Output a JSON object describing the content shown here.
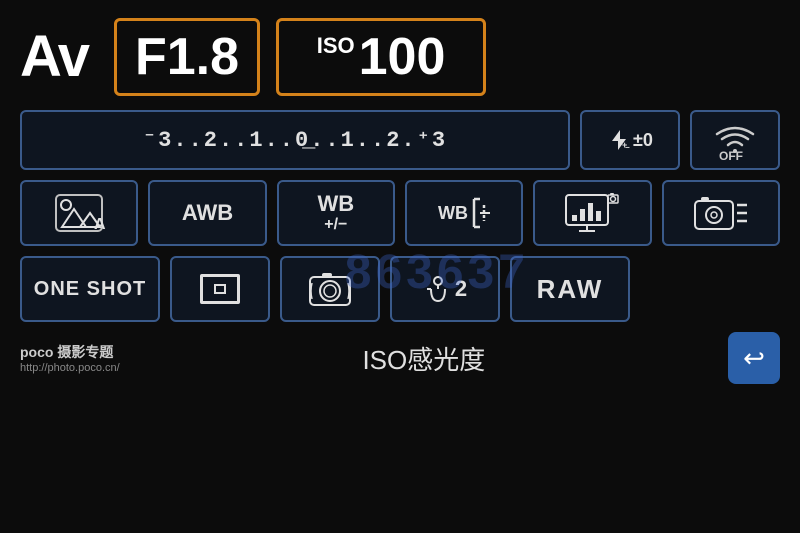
{
  "screen": {
    "mode": "Av",
    "aperture": "F1.8",
    "iso_label": "ISO",
    "iso_value": "100",
    "exposure_scale": "⁻3..2..1..0̲..1..2.⁺3",
    "flash_label": "±0",
    "wifi_label": "OFF",
    "metering_label": "A",
    "wb_label": "AWB",
    "wb_adjust_label": "WB\n+/−",
    "wb_bracket_label": "WB",
    "display_label": "",
    "camera_settings_label": "",
    "one_shot_label": "ONE SHOT",
    "raw_label": "RAW",
    "timer_label": "2",
    "bottom_iso_label": "ISO感光度",
    "poco_brand": "poco 摄影专题",
    "poco_url": "http://photo.poco.cn/",
    "back_button_symbol": "↩",
    "watermark": "863637"
  }
}
